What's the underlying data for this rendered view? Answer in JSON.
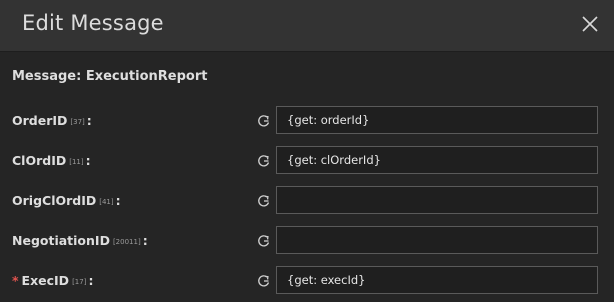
{
  "dialog": {
    "title": "Edit Message",
    "section_title": "Message: ExecutionReport",
    "fields": [
      {
        "label": "OrderID",
        "tag": "[37]",
        "value": "{get: orderId}",
        "required": false
      },
      {
        "label": "ClOrdID",
        "tag": "[11]",
        "value": "{get: clOrderId}",
        "required": false
      },
      {
        "label": "OrigClOrdID",
        "tag": "[41]",
        "value": "",
        "required": false
      },
      {
        "label": "NegotiationID",
        "tag": "[20011]",
        "value": "",
        "required": false
      },
      {
        "label": "ExecID",
        "tag": "[17]",
        "value": "{get: execId}",
        "required": true,
        "required_mark": "*"
      }
    ]
  },
  "icons": {
    "close": "close-icon",
    "reset": "reset-icon"
  },
  "colors": {
    "header_bg": "#333333",
    "body_bg": "#252525",
    "required": "#e2544f",
    "field_border": "#5a5a5a"
  }
}
